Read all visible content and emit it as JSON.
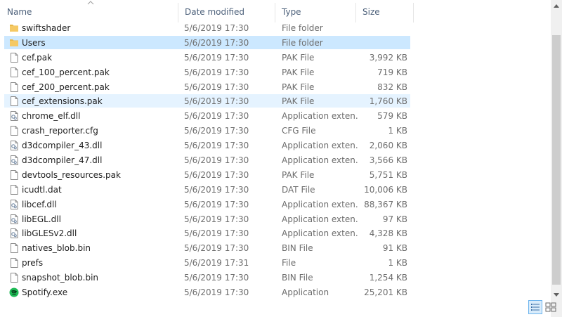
{
  "header": {
    "columns": [
      {
        "id": "name",
        "label": "Name"
      },
      {
        "id": "date",
        "label": "Date modified"
      },
      {
        "id": "type",
        "label": "Type"
      },
      {
        "id": "size",
        "label": "Size"
      }
    ],
    "sorted_column": "name"
  },
  "files": [
    {
      "icon": "folder-icon",
      "name": "swiftshader",
      "date": "5/6/2019 17:30",
      "type": "File folder",
      "size": ""
    },
    {
      "icon": "folder-icon",
      "name": "Users",
      "date": "5/6/2019 17:30",
      "type": "File folder",
      "size": "",
      "state": "selected"
    },
    {
      "icon": "file-icon",
      "name": "cef.pak",
      "date": "5/6/2019 17:30",
      "type": "PAK File",
      "size": "3,992 KB"
    },
    {
      "icon": "file-icon",
      "name": "cef_100_percent.pak",
      "date": "5/6/2019 17:30",
      "type": "PAK File",
      "size": "719 KB"
    },
    {
      "icon": "file-icon",
      "name": "cef_200_percent.pak",
      "date": "5/6/2019 17:30",
      "type": "PAK File",
      "size": "832 KB"
    },
    {
      "icon": "file-icon",
      "name": "cef_extensions.pak",
      "date": "5/6/2019 17:30",
      "type": "PAK File",
      "size": "1,760 KB",
      "state": "hover"
    },
    {
      "icon": "dll-icon",
      "name": "chrome_elf.dll",
      "date": "5/6/2019 17:30",
      "type": "Application exten...",
      "size": "579 KB"
    },
    {
      "icon": "file-icon",
      "name": "crash_reporter.cfg",
      "date": "5/6/2019 17:30",
      "type": "CFG File",
      "size": "1 KB"
    },
    {
      "icon": "dll-icon",
      "name": "d3dcompiler_43.dll",
      "date": "5/6/2019 17:30",
      "type": "Application exten...",
      "size": "2,060 KB"
    },
    {
      "icon": "dll-icon",
      "name": "d3dcompiler_47.dll",
      "date": "5/6/2019 17:30",
      "type": "Application exten...",
      "size": "3,566 KB"
    },
    {
      "icon": "file-icon",
      "name": "devtools_resources.pak",
      "date": "5/6/2019 17:30",
      "type": "PAK File",
      "size": "5,751 KB"
    },
    {
      "icon": "file-icon",
      "name": "icudtl.dat",
      "date": "5/6/2019 17:30",
      "type": "DAT File",
      "size": "10,006 KB"
    },
    {
      "icon": "dll-icon",
      "name": "libcef.dll",
      "date": "5/6/2019 17:30",
      "type": "Application exten...",
      "size": "88,367 KB"
    },
    {
      "icon": "dll-icon",
      "name": "libEGL.dll",
      "date": "5/6/2019 17:30",
      "type": "Application exten...",
      "size": "97 KB"
    },
    {
      "icon": "dll-icon",
      "name": "libGLESv2.dll",
      "date": "5/6/2019 17:30",
      "type": "Application exten...",
      "size": "4,328 KB"
    },
    {
      "icon": "file-icon",
      "name": "natives_blob.bin",
      "date": "5/6/2019 17:30",
      "type": "BIN File",
      "size": "91 KB"
    },
    {
      "icon": "file-icon",
      "name": "prefs",
      "date": "5/6/2019 17:31",
      "type": "File",
      "size": "1 KB"
    },
    {
      "icon": "file-icon",
      "name": "snapshot_blob.bin",
      "date": "5/6/2019 17:30",
      "type": "BIN File",
      "size": "1,254 KB"
    },
    {
      "icon": "spotify-icon",
      "name": "Spotify.exe",
      "date": "5/6/2019 17:30",
      "type": "Application",
      "size": "25,201 KB"
    }
  ],
  "colors": {
    "selected_bg": "#cce8ff",
    "hover_bg": "#e5f3ff",
    "folder": "#e8b84a",
    "spotify": "#1db954",
    "header_text": "#4c607a"
  },
  "view": {
    "mode": "details"
  }
}
